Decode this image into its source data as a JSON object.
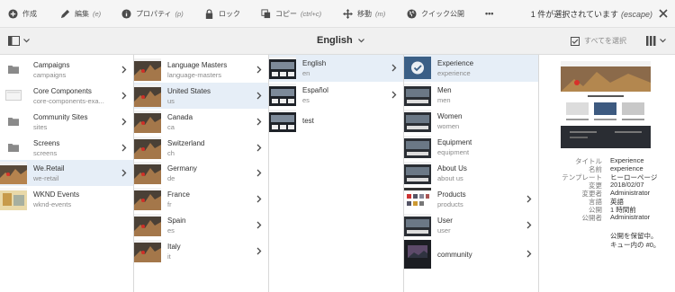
{
  "toolbar": {
    "create": "作成",
    "edit": "編集",
    "edit_sc": "(e)",
    "props": "プロパティ",
    "props_sc": "(p)",
    "lock": "ロック",
    "copy": "コピー",
    "copy_sc": "(ctrl+c)",
    "move": "移動",
    "move_sc": "(m)",
    "publish": "クイック公開",
    "more": "•••"
  },
  "selection": {
    "text": "1 件が選択されています",
    "shortcut": "(escape)"
  },
  "subbar": {
    "title": "English",
    "select_all": "すべてを選択"
  },
  "col1": [
    {
      "title": "Campaigns",
      "sub": "campaigns",
      "type": "folder"
    },
    {
      "title": "Core Components",
      "sub": "core-components-exa...",
      "type": "page-blank"
    },
    {
      "title": "Community Sites",
      "sub": "sites",
      "type": "folder"
    },
    {
      "title": "Screens",
      "sub": "screens",
      "type": "folder"
    },
    {
      "title": "We.Retail",
      "sub": "we-retail",
      "type": "thumb"
    },
    {
      "title": "WKND Events",
      "sub": "wknd-events",
      "type": "thumb2"
    }
  ],
  "col2": [
    {
      "title": "Language Masters",
      "sub": "language-masters"
    },
    {
      "title": "United States",
      "sub": "us"
    },
    {
      "title": "Canada",
      "sub": "ca"
    },
    {
      "title": "Switzerland",
      "sub": "ch"
    },
    {
      "title": "Germany",
      "sub": "de"
    },
    {
      "title": "France",
      "sub": "fr"
    },
    {
      "title": "Spain",
      "sub": "es"
    },
    {
      "title": "Italy",
      "sub": "it"
    }
  ],
  "col3": [
    {
      "title": "English",
      "sub": "en"
    },
    {
      "title": "Español",
      "sub": "es"
    },
    {
      "title": "test",
      "sub": ""
    }
  ],
  "col4": [
    {
      "title": "Experience",
      "sub": "experience"
    },
    {
      "title": "Men",
      "sub": "men"
    },
    {
      "title": "Women",
      "sub": "women"
    },
    {
      "title": "Equipment",
      "sub": "equipment"
    },
    {
      "title": "About Us",
      "sub": "about us"
    },
    {
      "title": "Products",
      "sub": "products"
    },
    {
      "title": "User",
      "sub": "user"
    },
    {
      "title": "community",
      "sub": ""
    }
  ],
  "meta": {
    "rows": [
      {
        "label": "タイトル",
        "value": "Experience"
      },
      {
        "label": "名前",
        "value": "experience"
      },
      {
        "label": "テンプレート",
        "value": "ヒーローページ"
      },
      {
        "label": "変更",
        "value": "2018/02/07"
      },
      {
        "label": "変更者",
        "value": "Administrator"
      },
      {
        "label": "言語",
        "value": "英語"
      },
      {
        "label": "公開",
        "value": "1 時間前"
      },
      {
        "label": "公開者",
        "value": "Administrator"
      }
    ],
    "note1": "公開を保留中。",
    "note2": "キュー内の #0。"
  }
}
